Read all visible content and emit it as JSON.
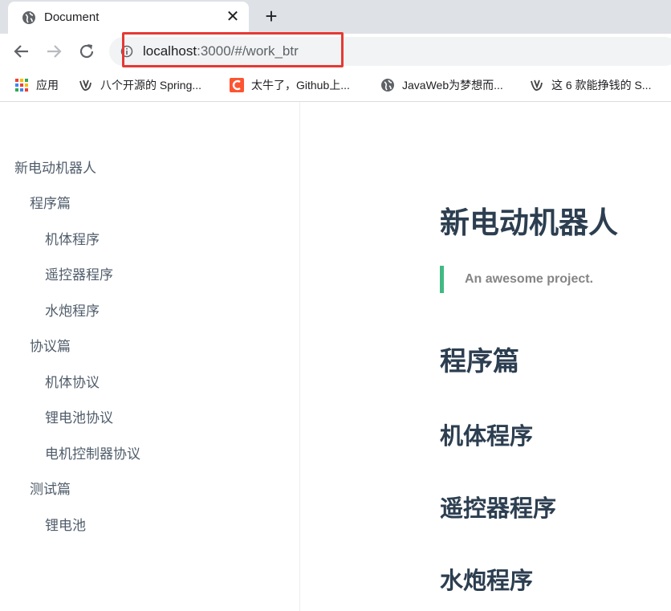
{
  "tab": {
    "title": "Document",
    "close_symbol": "✕",
    "new_tab_symbol": "+"
  },
  "address_bar": {
    "host": "localhost",
    "path": ":3000/#/work_btr",
    "highlight_color": "#e53935"
  },
  "bookmarks": [
    {
      "icon": "apps-grid-icon",
      "label": "应用"
    },
    {
      "icon": "bookmark-favicon-icon",
      "label": "八个开源的 Spring..."
    },
    {
      "icon": "csdn-icon",
      "label": "太牛了，Github上..."
    },
    {
      "icon": "globe-icon",
      "label": "JavaWeb为梦想而..."
    },
    {
      "icon": "bookmark-favicon-icon",
      "label": "这 6 款能挣钱的 S..."
    }
  ],
  "sidebar": {
    "items": [
      {
        "label": "新电动机器人",
        "level": 0
      },
      {
        "label": "程序篇",
        "level": 1
      },
      {
        "label": "机体程序",
        "level": 2
      },
      {
        "label": "遥控器程序",
        "level": 2
      },
      {
        "label": "水炮程序",
        "level": 2
      },
      {
        "label": "协议篇",
        "level": 1
      },
      {
        "label": "机体协议",
        "level": 2
      },
      {
        "label": "锂电池协议",
        "level": 2
      },
      {
        "label": "电机控制器协议",
        "level": 2
      },
      {
        "label": "测试篇",
        "level": 1
      },
      {
        "label": "锂电池",
        "level": 2
      }
    ]
  },
  "content": {
    "title": "新电动机器人",
    "blockquote": "An awesome project.",
    "section": "程序篇",
    "subsections": [
      "机体程序",
      "遥控器程序",
      "水炮程序"
    ],
    "accent_color": "#42b983"
  }
}
